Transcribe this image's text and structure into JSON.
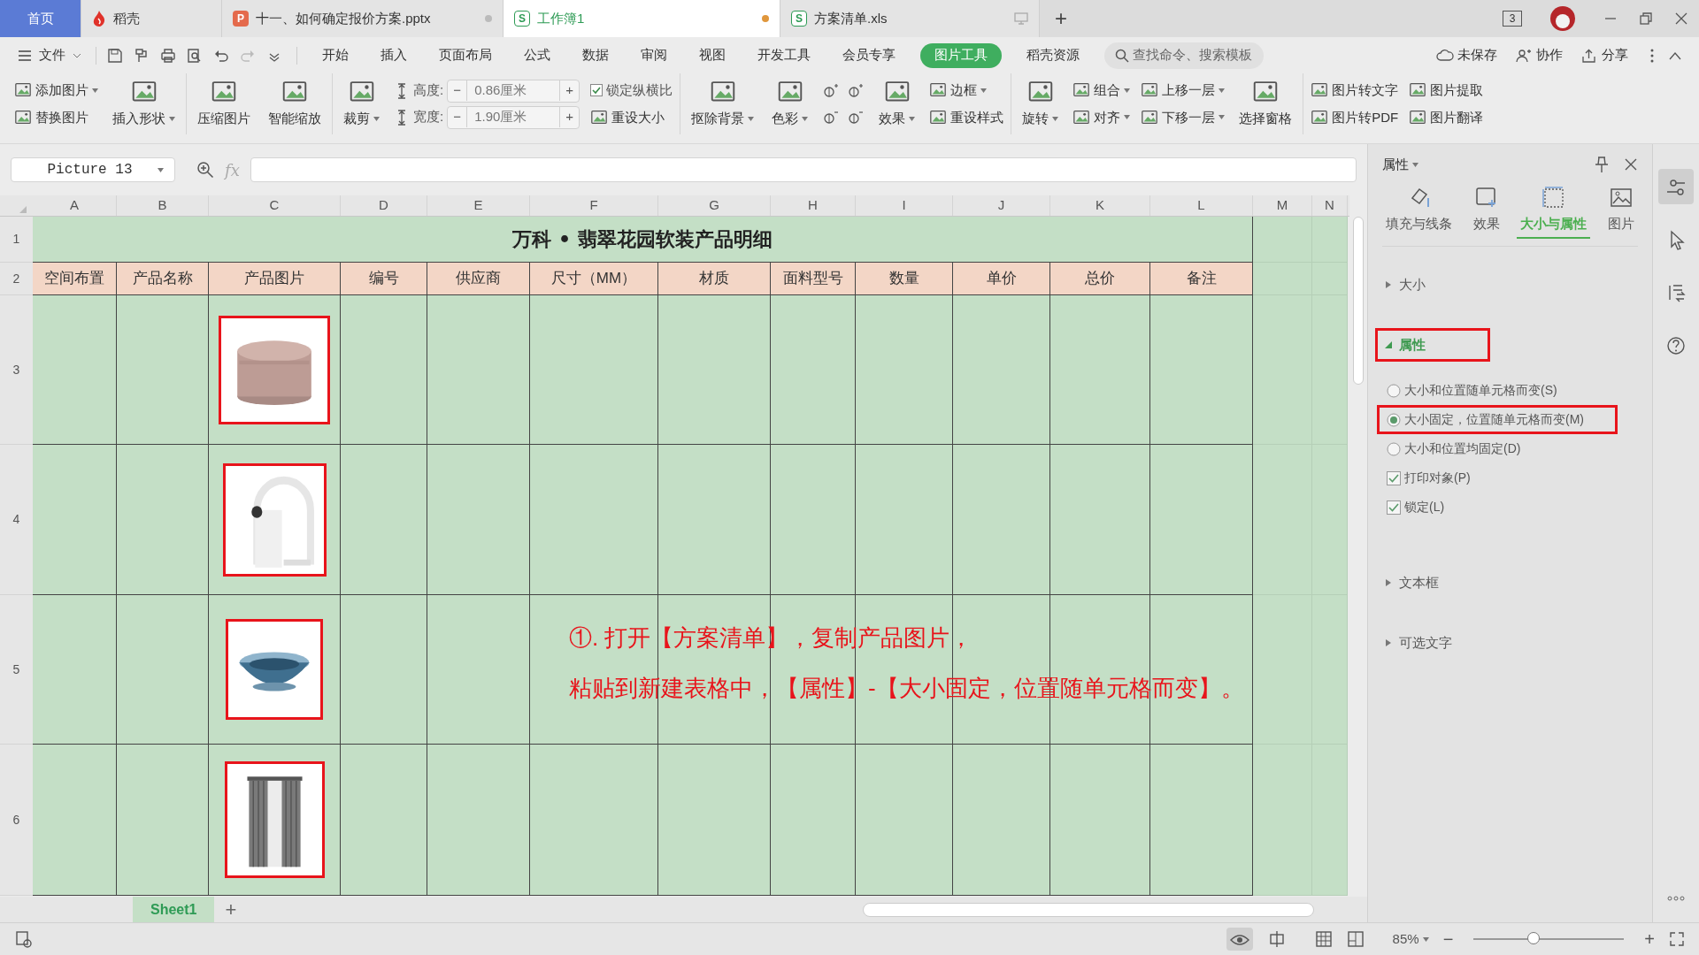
{
  "tabs": [
    {
      "label": "首页",
      "kind": "home",
      "selected": false
    },
    {
      "label": "稻壳",
      "kind": "docer",
      "selected": false
    },
    {
      "label": "十一、如何确定报价方案.pptx",
      "kind": "presentation",
      "badge": "P",
      "selected": false
    },
    {
      "label": "工作簿1",
      "kind": "workbook",
      "badge": "S",
      "selected": true
    },
    {
      "label": "方案清单.xls",
      "kind": "file",
      "badge": "S",
      "selected": false
    }
  ],
  "new_tab": "+",
  "window_badge": "3",
  "menu": {
    "file": "文件",
    "items": [
      {
        "label": "开始",
        "selected": false
      },
      {
        "label": "插入",
        "selected": false
      },
      {
        "label": "页面布局",
        "selected": false
      },
      {
        "label": "公式",
        "selected": false
      },
      {
        "label": "数据",
        "selected": false
      },
      {
        "label": "审阅",
        "selected": false
      },
      {
        "label": "视图",
        "selected": false
      },
      {
        "label": "开发工具",
        "selected": false
      },
      {
        "label": "会员专享",
        "selected": false
      },
      {
        "label": "图片工具",
        "selected": true
      },
      {
        "label": "稻壳资源",
        "selected": false
      }
    ],
    "search": {
      "placeholder": "查找命令、搜索模板"
    },
    "actions": [
      "未保存",
      "协作",
      "分享"
    ]
  },
  "ribbon": [
    [
      {
        "kind": "stack",
        "items": [
          {
            "kind": "button",
            "label": "添加图片",
            "dropdown": true
          },
          {
            "kind": "button",
            "label": "替换图片",
            "dropdown": false
          }
        ]
      },
      {
        "kind": "big",
        "label": "插入形状",
        "dropdown": true
      }
    ],
    [
      {
        "kind": "big",
        "label": "压缩图片",
        "dropdown": false
      },
      {
        "kind": "big",
        "label": "智能缩放",
        "dropdown": false
      }
    ],
    [
      {
        "kind": "big",
        "label": "裁剪",
        "dropdown": true
      },
      {
        "kind": "fields",
        "items": [
          {
            "label": "高度:",
            "value": "0.86厘米",
            "minus": "−",
            "plus": "+"
          },
          {
            "label": "宽度:",
            "value": "1.90厘米",
            "minus": "−",
            "plus": "+"
          }
        ]
      },
      {
        "kind": "stack",
        "items": [
          {
            "kind": "checkbox",
            "label": "锁定纵横比",
            "checked": true
          },
          {
            "kind": "button",
            "label": "重设大小",
            "dropdown": false
          }
        ]
      }
    ],
    [
      {
        "kind": "big",
        "label": "抠除背景",
        "dropdown": true
      },
      {
        "kind": "big",
        "label": "色彩",
        "dropdown": true
      },
      {
        "kind": "icons"
      },
      {
        "kind": "big",
        "label": "效果",
        "dropdown": true
      },
      {
        "kind": "stack",
        "items": [
          {
            "kind": "button",
            "label": "边框",
            "dropdown": true
          },
          {
            "kind": "button",
            "label": "重设样式",
            "dropdown": false
          }
        ]
      }
    ],
    [
      {
        "kind": "big",
        "label": "旋转",
        "dropdown": true
      },
      {
        "kind": "stack",
        "items": [
          {
            "kind": "button",
            "label": "组合",
            "dropdown": true
          },
          {
            "kind": "button",
            "label": "对齐",
            "dropdown": true
          }
        ]
      },
      {
        "kind": "stack",
        "items": [
          {
            "kind": "button",
            "label": "上移一层",
            "dropdown": true
          },
          {
            "kind": "button",
            "label": "下移一层",
            "dropdown": true
          }
        ]
      },
      {
        "kind": "big",
        "label": "选择窗格",
        "dropdown": false
      }
    ],
    [
      {
        "kind": "stack",
        "items": [
          {
            "kind": "button",
            "label": "图片转文字",
            "dropdown": false
          },
          {
            "kind": "button",
            "label": "图片转PDF",
            "dropdown": false
          }
        ]
      },
      {
        "kind": "stack",
        "items": [
          {
            "kind": "button",
            "label": "图片提取",
            "dropdown": false
          },
          {
            "kind": "button",
            "label": "图片翻译",
            "dropdown": false
          }
        ]
      }
    ]
  ],
  "formula_bar": {
    "name_box": "Picture 13",
    "fx": "fx"
  },
  "sheet": {
    "columns": [
      "A",
      "B",
      "C",
      "D",
      "E",
      "F",
      "G",
      "H",
      "I",
      "J",
      "K",
      "L",
      "M",
      "N"
    ],
    "rows": [
      "1",
      "2",
      "3",
      "4",
      "5",
      "6"
    ],
    "title": "万科 • 翡翠花园软装产品明细",
    "headers": [
      "空间布置",
      "产品名称",
      "产品图片",
      "编号",
      "供应商",
      "尺寸（MM）",
      "材质",
      "面料型号",
      "数量",
      "单价",
      "总价",
      "备注"
    ]
  },
  "annotation": [
    "①. 打开【方案清单】，复制产品图片，",
    "粘贴到新建表格中，【属性】-【大小固定，位置随单元格而变】。"
  ],
  "panel": {
    "title": "属性",
    "tabs": [
      {
        "label": "填充与线条",
        "selected": false
      },
      {
        "label": "效果",
        "selected": false
      },
      {
        "label": "大小与属性",
        "selected": true
      },
      {
        "label": "图片",
        "selected": false
      }
    ],
    "sections": [
      {
        "label": "大小",
        "expanded": false,
        "highlighted": false
      },
      {
        "label": "属性",
        "expanded": true,
        "highlighted": true,
        "options": [
          {
            "kind": "radio",
            "label": "大小和位置随单元格而变(S)",
            "selected": false,
            "highlighted": false
          },
          {
            "kind": "radio",
            "label": "大小固定，位置随单元格而变(M)",
            "selected": true,
            "highlighted": true
          },
          {
            "kind": "radio",
            "label": "大小和位置均固定(D)",
            "selected": false,
            "highlighted": false
          },
          {
            "kind": "checkbox",
            "label": "打印对象(P)",
            "checked": true,
            "highlighted": false
          },
          {
            "kind": "checkbox",
            "label": "锁定(L)",
            "checked": true,
            "highlighted": false
          }
        ]
      },
      {
        "label": "文本框",
        "expanded": false,
        "highlighted": false
      },
      {
        "label": "可选文字",
        "expanded": false,
        "highlighted": false
      }
    ]
  },
  "sheet_tabs": [
    {
      "label": "Sheet1",
      "selected": true
    }
  ],
  "add_sheet": "+",
  "status": {
    "zoom": "85%",
    "minus": "−",
    "plus": "+",
    "level": 0.4
  }
}
